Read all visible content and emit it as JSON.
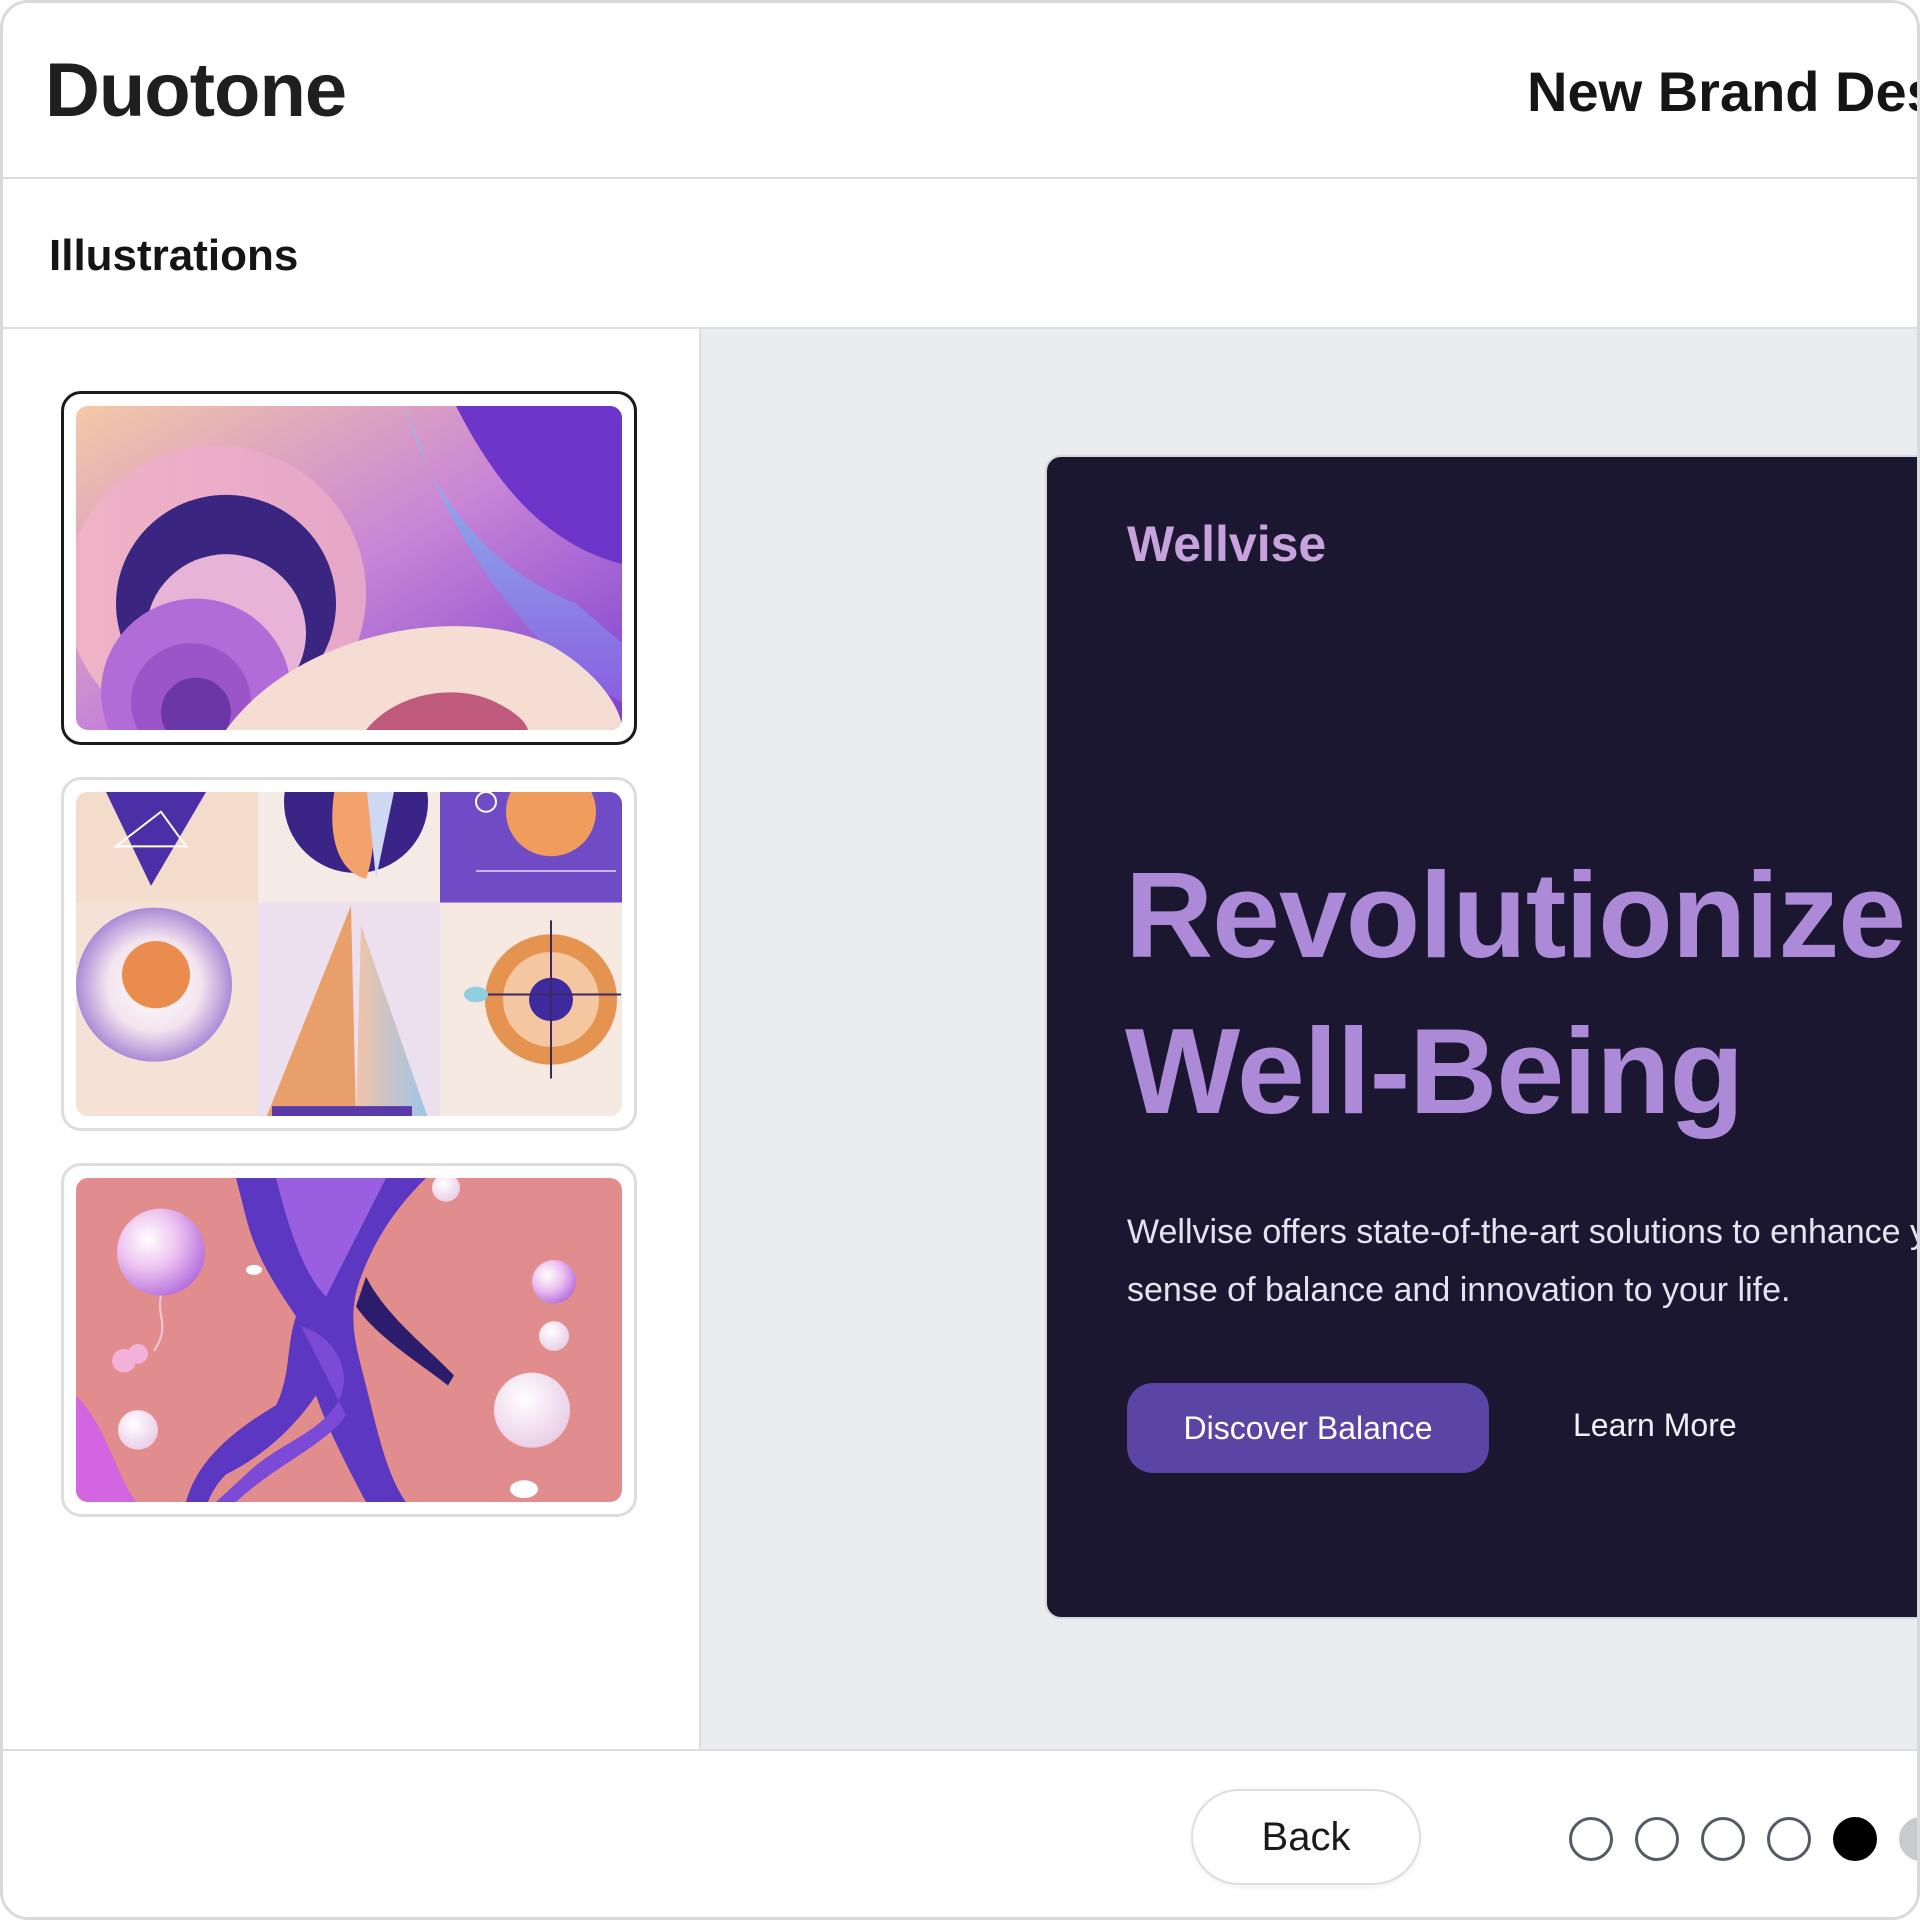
{
  "app": {
    "title": "Duotone",
    "document_title": "New Brand Desi"
  },
  "section": {
    "title": "Illustrations"
  },
  "sidebar": {
    "thumbnails": [
      {
        "name": "swirl-illustration",
        "selected": true
      },
      {
        "name": "geometric-grid-illustration",
        "selected": false
      },
      {
        "name": "dancer-illustration",
        "selected": false
      }
    ]
  },
  "preview": {
    "brand": "Wellvise",
    "heading": "Revolutionize Your Well-Being",
    "body": "Wellvise offers state-of-the-art solutions to enhance your well-being and bring a sense of balance and innovation to your life.",
    "primary_cta": "Discover Balance",
    "secondary_cta": "Learn More",
    "colors": {
      "card_bg": "#1c1730",
      "heading": "#ad8ad8",
      "brand": "#c8a2dc",
      "button": "#5a44a4"
    }
  },
  "footer": {
    "back_label": "Back",
    "pagination": {
      "current_step": 5,
      "visible_dots": 6
    }
  }
}
